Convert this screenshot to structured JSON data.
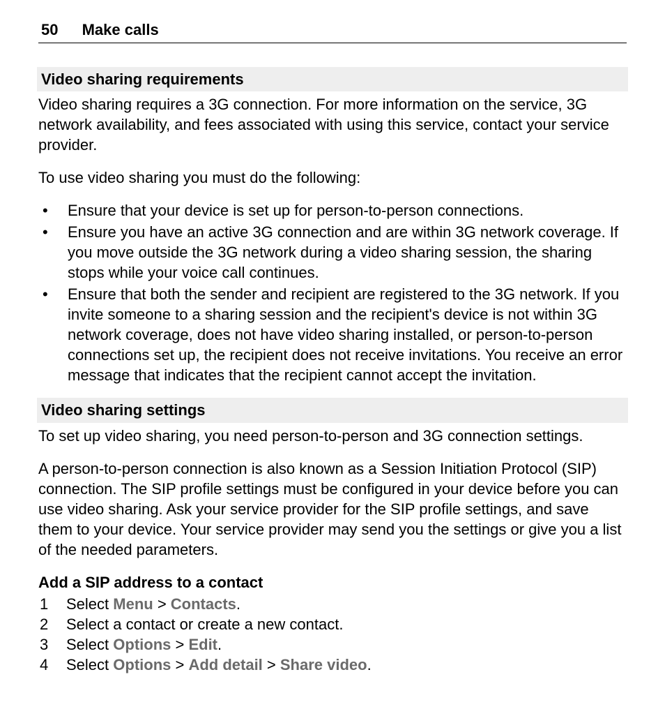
{
  "header": {
    "page_number": "50",
    "section_title": "Make calls"
  },
  "sections": {
    "requirements": {
      "heading": "Video sharing requirements",
      "intro": "Video sharing requires a 3G connection. For more information on the service, 3G network availability, and fees associated with using this service, contact your service provider.",
      "lead_in": "To use video sharing you must do the following:",
      "bullets": [
        "Ensure that your device is set up for person-to-person connections.",
        "Ensure you have an active 3G connection and are within 3G network coverage. If you move outside the 3G network during a video sharing session, the sharing stops while your voice call continues.",
        "Ensure that both the sender and recipient are registered to the 3G network. If you invite someone to a sharing session and the recipient's device is not within 3G network coverage, does not have video sharing installed, or person-to-person connections set up, the recipient does not receive invitations. You receive an error message that indicates that the recipient cannot accept the invitation."
      ]
    },
    "settings": {
      "heading": "Video sharing settings",
      "intro": "To set up video sharing, you need person-to-person and 3G connection settings.",
      "body": "A person-to-person connection is also known as a Session Initiation Protocol (SIP) connection. The SIP profile settings must be configured in your device before you can use video sharing. Ask your service provider for the SIP profile settings, and save them to your device. Your service provider may send you the settings or give you a list of the needed parameters."
    },
    "sip": {
      "heading": "Add a SIP address to a contact",
      "steps": {
        "s1_select": "Select ",
        "s1_menu": "Menu",
        "s1_gt": " > ",
        "s1_contacts": "Contacts",
        "s1_end": ".",
        "s2": "Select a contact or create a new contact.",
        "s3_select": "Select ",
        "s3_options": "Options",
        "s3_gt": " > ",
        "s3_edit": "Edit",
        "s3_end": ".",
        "s4_select": "Select ",
        "s4_options": "Options",
        "s4_gt1": " > ",
        "s4_add": "Add detail",
        "s4_gt2": " > ",
        "s4_share": "Share video",
        "s4_end": "."
      }
    }
  }
}
